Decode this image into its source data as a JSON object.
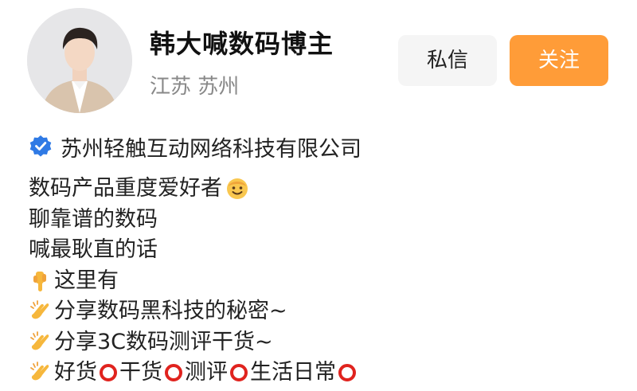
{
  "profile": {
    "name": "韩大喊数码博主",
    "location": "江苏 苏州",
    "avatar_icon": "person-avatar"
  },
  "actions": {
    "message_label": "私信",
    "follow_label": "关注",
    "follow_color": "#ff9c38"
  },
  "verification": {
    "icon": "verified-badge-icon",
    "icon_color": "#2f7ae5",
    "company": "苏州轻触互动网络科技有限公司"
  },
  "bio": {
    "line1": "数码产品重度爱好者",
    "line1_emoji": "smiling-face-icon",
    "line2": "聊靠谱的数码",
    "line3": "喊最耿直的话",
    "line4": "这里有",
    "line4_emoji": "pointing-down-icon",
    "line5": "分享数码黑科技的秘密~",
    "line6": "分享3C数码测评干货~",
    "line7_tags": [
      "好货",
      "干货",
      "测评",
      "生活日常"
    ],
    "clap_emoji": "clapping-hands-icon",
    "ring_emoji": "red-circle-icon"
  }
}
